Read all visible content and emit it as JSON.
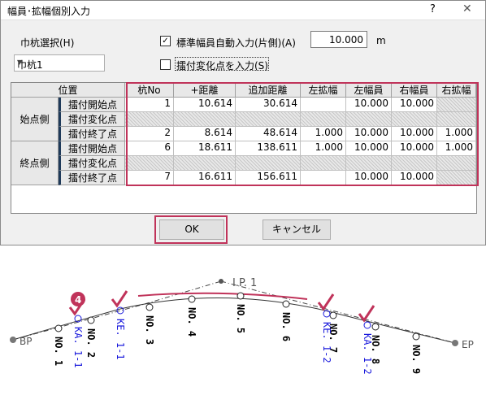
{
  "dialog": {
    "title": "幅員･拡幅個別入力",
    "help": "?",
    "close": "✕",
    "station_select_label": "巾杭選択(H)",
    "station_select_value": "巾杭1",
    "auto_width_label": "標準幅員自動入力(片側)(A)",
    "auto_width_value": "10.000",
    "auto_width_unit": "m",
    "input_change_point_label": "擂付変化点を入力(S)",
    "ok": "OK",
    "cancel": "キャンセル"
  },
  "grid": {
    "pos_header": "位置",
    "columns": [
      "杭No",
      "+距離",
      "追加距離",
      "左拡幅",
      "左幅員",
      "右幅員",
      "右拡幅"
    ],
    "groups": [
      "始点側",
      "終点側"
    ],
    "rows": [
      {
        "pos": "擂付開始点",
        "no": "1",
        "plus": "10.614",
        "add": "30.614",
        "lw": "",
        "lwid": "10.000",
        "rwid": "10.000",
        "rw": ""
      },
      {
        "pos": "擂付変化点",
        "no": "",
        "plus": "",
        "add": "",
        "lw": "",
        "lwid": "",
        "rwid": "",
        "rw": ""
      },
      {
        "pos": "擂付終了点",
        "no": "2",
        "plus": "8.614",
        "add": "48.614",
        "lw": "1.000",
        "lwid": "10.000",
        "rwid": "10.000",
        "rw": "1.000"
      },
      {
        "pos": "擂付開始点",
        "no": "6",
        "plus": "18.611",
        "add": "138.611",
        "lw": "1.000",
        "lwid": "10.000",
        "rwid": "10.000",
        "rw": "1.000"
      },
      {
        "pos": "擂付変化点",
        "no": "",
        "plus": "",
        "add": "",
        "lw": "",
        "lwid": "",
        "rwid": "",
        "rw": ""
      },
      {
        "pos": "擂付終了点",
        "no": "7",
        "plus": "16.611",
        "add": "156.611",
        "lw": "",
        "lwid": "10.000",
        "rwid": "10.000",
        "rw": ""
      }
    ]
  },
  "map": {
    "ip": "I.P. 1",
    "bp": "BP",
    "ep": "EP",
    "step": "4",
    "stations": [
      "NO. 1",
      "NO. 2",
      "NO. 3",
      "NO. 4",
      "NO. 5",
      "NO. 6",
      "NO. 7",
      "NO. 8",
      "NO. 9"
    ],
    "ka": [
      "KA. 1-1",
      "KE. 1-1",
      "KE. 1-2",
      "KA. 1-2"
    ],
    "colors": {
      "accent": "#c0335a",
      "blue": "#1a1adc"
    }
  }
}
